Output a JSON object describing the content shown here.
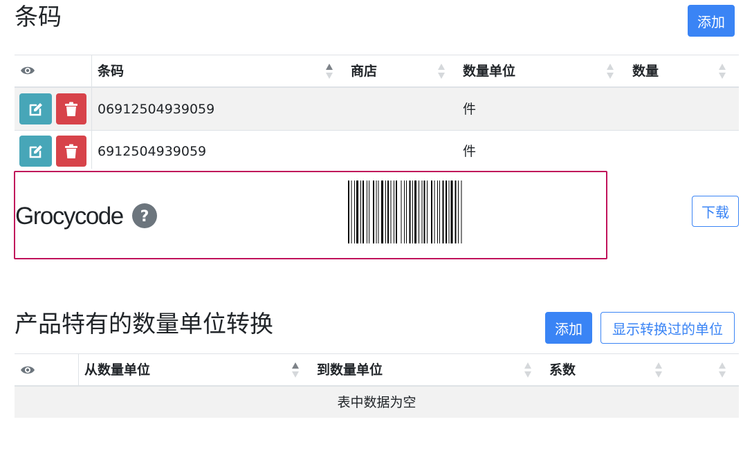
{
  "barcodes_section": {
    "title": "条码",
    "add_label": "添加",
    "columns": [
      "条码",
      "商店",
      "数量单位",
      "数量"
    ],
    "rows": [
      {
        "barcode": "06912504939059",
        "store": "",
        "unit": "件",
        "amount": ""
      },
      {
        "barcode": "6912504939059",
        "store": "",
        "unit": "件",
        "amount": ""
      }
    ]
  },
  "grocycode": {
    "title": "Grocycode",
    "download_label": "下载",
    "help_icon": "question-circle-icon"
  },
  "conversions_section": {
    "title": "产品特有的数量单位转换",
    "add_label": "添加",
    "show_converted_label": "显示转换过的单位",
    "columns": [
      "从数量单位",
      "到数量单位",
      "系数"
    ],
    "empty_text": "表中数据为空"
  },
  "colors": {
    "primary": "#3a84f5",
    "edit": "#47a6b8",
    "delete": "#d7434a",
    "highlight_border": "#c0125a",
    "help_icon": "#6c757d"
  }
}
